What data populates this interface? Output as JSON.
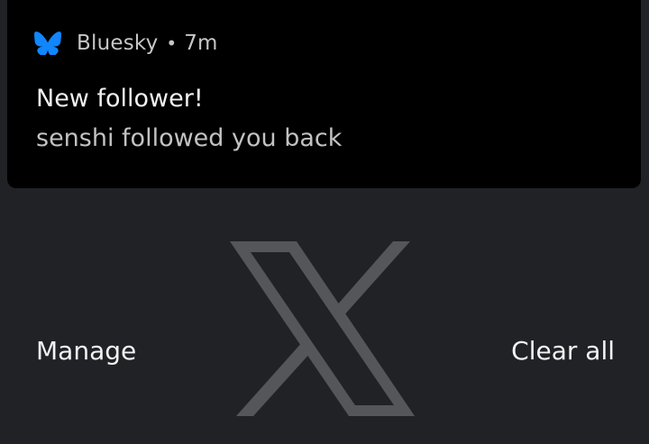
{
  "notification": {
    "app_icon": "butterfly-icon",
    "app_name": "Bluesky",
    "separator": "•",
    "time": "7m",
    "title": "New follower!",
    "body": "senshi followed you back"
  },
  "background": {
    "logo_icon": "x-logo-icon"
  },
  "actions": {
    "manage_label": "Manage",
    "clear_all_label": "Clear all"
  },
  "colors": {
    "background": "#212226",
    "card": "#000000",
    "bluesky_blue": "#1186fe",
    "x_logo_gray": "#555659"
  }
}
